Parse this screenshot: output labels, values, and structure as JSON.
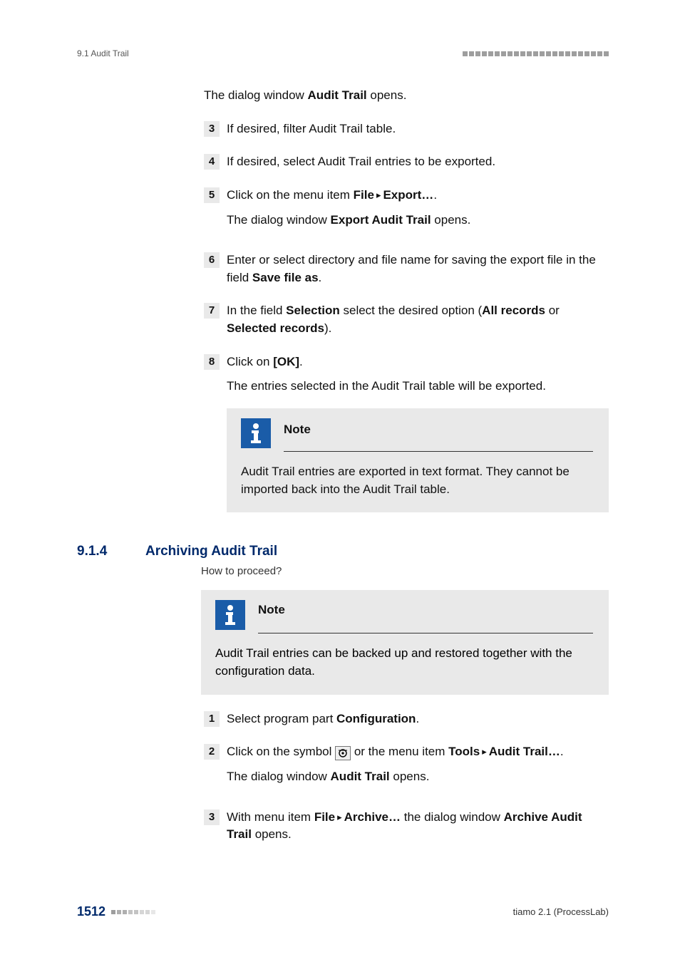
{
  "header": {
    "section_ref": "9.1 Audit Trail"
  },
  "intro_para": {
    "pre": "The dialog window ",
    "bold": "Audit Trail",
    "post": " opens."
  },
  "stepsA": {
    "s3": {
      "num": "3",
      "text": "If desired, filter Audit Trail table."
    },
    "s4": {
      "num": "4",
      "text": "If desired, select Audit Trail entries to be exported."
    },
    "s5": {
      "num": "5",
      "l1_pre": "Click on the menu item ",
      "l1_b1": "File",
      "l1_b2": "Export…",
      "l1_post": ".",
      "l2_pre": "The dialog window ",
      "l2_b": "Export Audit Trail",
      "l2_post": " opens."
    },
    "s6": {
      "num": "6",
      "pre": "Enter or select directory and file name for saving the export file in the field ",
      "b": "Save file as",
      "post": "."
    },
    "s7": {
      "num": "7",
      "pre": "In the field ",
      "b1": "Selection",
      "mid": " select the desired option (",
      "b2": "All records",
      "or": " or ",
      "b3": "Selected records",
      "post": ")."
    },
    "s8": {
      "num": "8",
      "l1_pre": "Click on ",
      "l1_b": "[OK]",
      "l1_post": ".",
      "l2": "The entries selected in the Audit Trail table will be exported."
    }
  },
  "noteA": {
    "title": "Note",
    "body": "Audit Trail entries are exported in text format. They cannot be imported back into the Audit Trail table."
  },
  "section": {
    "num": "9.1.4",
    "title": "Archiving Audit Trail",
    "howto": "How to proceed?"
  },
  "noteB": {
    "title": "Note",
    "body": "Audit Trail entries can be backed up and restored together with the configuration data."
  },
  "stepsB": {
    "s1": {
      "num": "1",
      "pre": "Select program part ",
      "b": "Configuration",
      "post": "."
    },
    "s2": {
      "num": "2",
      "l1_pre": "Click on the symbol ",
      "l1_mid": " or the menu item ",
      "l1_b1": "Tools",
      "l1_b2": "Audit Trail…",
      "l1_post": ".",
      "l2_pre": "The dialog window ",
      "l2_b": "Audit Trail",
      "l2_post": " opens."
    },
    "s3": {
      "num": "3",
      "pre": "With menu item ",
      "b1": "File",
      "b2": "Archive…",
      "mid": " the dialog window ",
      "b3": "Archive Audit Trail",
      "post": " opens."
    }
  },
  "footer": {
    "page": "1512",
    "product": "tiamo 2.1 (ProcessLab)"
  }
}
